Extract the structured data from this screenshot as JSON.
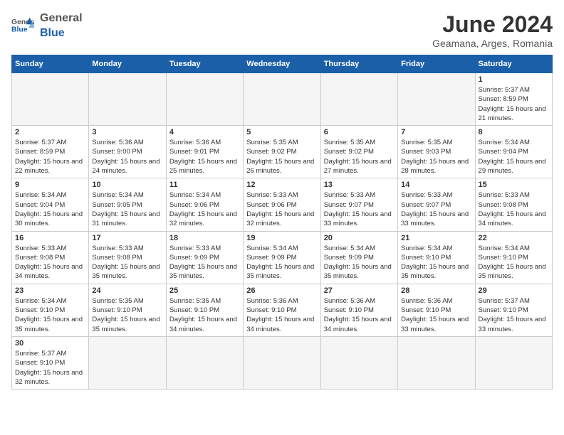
{
  "header": {
    "logo_general": "General",
    "logo_blue": "Blue",
    "month_title": "June 2024",
    "subtitle": "Geamana, Arges, Romania"
  },
  "weekdays": [
    "Sunday",
    "Monday",
    "Tuesday",
    "Wednesday",
    "Thursday",
    "Friday",
    "Saturday"
  ],
  "weeks": [
    [
      {
        "day": "",
        "info": ""
      },
      {
        "day": "",
        "info": ""
      },
      {
        "day": "",
        "info": ""
      },
      {
        "day": "",
        "info": ""
      },
      {
        "day": "",
        "info": ""
      },
      {
        "day": "",
        "info": ""
      },
      {
        "day": "1",
        "info": "Sunrise: 5:37 AM\nSunset: 8:59 PM\nDaylight: 15 hours and 21 minutes."
      }
    ],
    [
      {
        "day": "2",
        "info": "Sunrise: 5:37 AM\nSunset: 8:59 PM\nDaylight: 15 hours and 22 minutes."
      },
      {
        "day": "3",
        "info": "Sunrise: 5:36 AM\nSunset: 9:00 PM\nDaylight: 15 hours and 24 minutes."
      },
      {
        "day": "4",
        "info": "Sunrise: 5:36 AM\nSunset: 9:01 PM\nDaylight: 15 hours and 25 minutes."
      },
      {
        "day": "5",
        "info": "Sunrise: 5:35 AM\nSunset: 9:02 PM\nDaylight: 15 hours and 26 minutes."
      },
      {
        "day": "6",
        "info": "Sunrise: 5:35 AM\nSunset: 9:02 PM\nDaylight: 15 hours and 27 minutes."
      },
      {
        "day": "7",
        "info": "Sunrise: 5:35 AM\nSunset: 9:03 PM\nDaylight: 15 hours and 28 minutes."
      },
      {
        "day": "8",
        "info": "Sunrise: 5:34 AM\nSunset: 9:04 PM\nDaylight: 15 hours and 29 minutes."
      }
    ],
    [
      {
        "day": "9",
        "info": "Sunrise: 5:34 AM\nSunset: 9:04 PM\nDaylight: 15 hours and 30 minutes."
      },
      {
        "day": "10",
        "info": "Sunrise: 5:34 AM\nSunset: 9:05 PM\nDaylight: 15 hours and 31 minutes."
      },
      {
        "day": "11",
        "info": "Sunrise: 5:34 AM\nSunset: 9:06 PM\nDaylight: 15 hours and 32 minutes."
      },
      {
        "day": "12",
        "info": "Sunrise: 5:33 AM\nSunset: 9:06 PM\nDaylight: 15 hours and 32 minutes."
      },
      {
        "day": "13",
        "info": "Sunrise: 5:33 AM\nSunset: 9:07 PM\nDaylight: 15 hours and 33 minutes."
      },
      {
        "day": "14",
        "info": "Sunrise: 5:33 AM\nSunset: 9:07 PM\nDaylight: 15 hours and 33 minutes."
      },
      {
        "day": "15",
        "info": "Sunrise: 5:33 AM\nSunset: 9:08 PM\nDaylight: 15 hours and 34 minutes."
      }
    ],
    [
      {
        "day": "16",
        "info": "Sunrise: 5:33 AM\nSunset: 9:08 PM\nDaylight: 15 hours and 34 minutes."
      },
      {
        "day": "17",
        "info": "Sunrise: 5:33 AM\nSunset: 9:08 PM\nDaylight: 15 hours and 35 minutes."
      },
      {
        "day": "18",
        "info": "Sunrise: 5:33 AM\nSunset: 9:09 PM\nDaylight: 15 hours and 35 minutes."
      },
      {
        "day": "19",
        "info": "Sunrise: 5:34 AM\nSunset: 9:09 PM\nDaylight: 15 hours and 35 minutes."
      },
      {
        "day": "20",
        "info": "Sunrise: 5:34 AM\nSunset: 9:09 PM\nDaylight: 15 hours and 35 minutes."
      },
      {
        "day": "21",
        "info": "Sunrise: 5:34 AM\nSunset: 9:10 PM\nDaylight: 15 hours and 35 minutes."
      },
      {
        "day": "22",
        "info": "Sunrise: 5:34 AM\nSunset: 9:10 PM\nDaylight: 15 hours and 35 minutes."
      }
    ],
    [
      {
        "day": "23",
        "info": "Sunrise: 5:34 AM\nSunset: 9:10 PM\nDaylight: 15 hours and 35 minutes."
      },
      {
        "day": "24",
        "info": "Sunrise: 5:35 AM\nSunset: 9:10 PM\nDaylight: 15 hours and 35 minutes."
      },
      {
        "day": "25",
        "info": "Sunrise: 5:35 AM\nSunset: 9:10 PM\nDaylight: 15 hours and 34 minutes."
      },
      {
        "day": "26",
        "info": "Sunrise: 5:36 AM\nSunset: 9:10 PM\nDaylight: 15 hours and 34 minutes."
      },
      {
        "day": "27",
        "info": "Sunrise: 5:36 AM\nSunset: 9:10 PM\nDaylight: 15 hours and 34 minutes."
      },
      {
        "day": "28",
        "info": "Sunrise: 5:36 AM\nSunset: 9:10 PM\nDaylight: 15 hours and 33 minutes."
      },
      {
        "day": "29",
        "info": "Sunrise: 5:37 AM\nSunset: 9:10 PM\nDaylight: 15 hours and 33 minutes."
      }
    ],
    [
      {
        "day": "30",
        "info": "Sunrise: 5:37 AM\nSunset: 9:10 PM\nDaylight: 15 hours and 32 minutes."
      },
      {
        "day": "",
        "info": ""
      },
      {
        "day": "",
        "info": ""
      },
      {
        "day": "",
        "info": ""
      },
      {
        "day": "",
        "info": ""
      },
      {
        "day": "",
        "info": ""
      },
      {
        "day": "",
        "info": ""
      }
    ]
  ]
}
